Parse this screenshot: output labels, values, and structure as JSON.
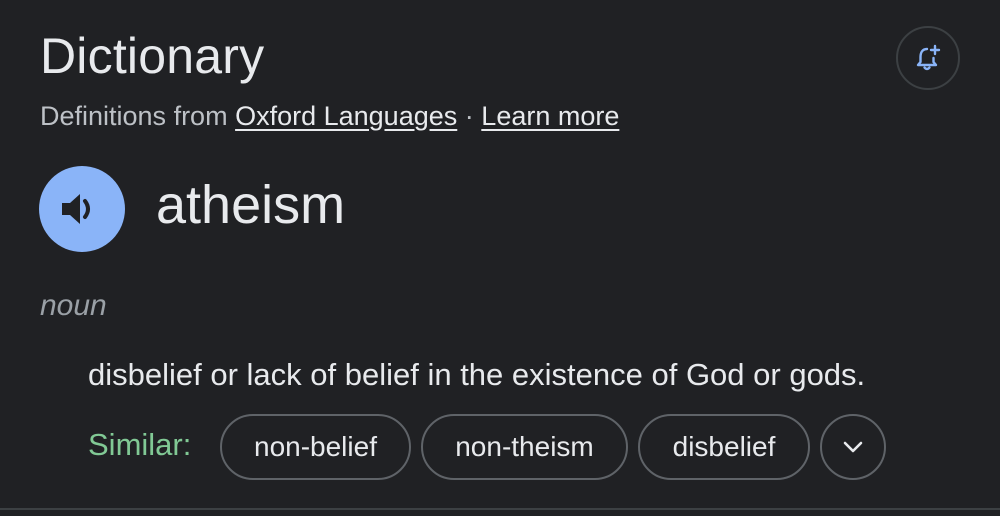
{
  "header": {
    "title": "Dictionary",
    "source_prefix": "Definitions from",
    "source_link": "Oxford Languages",
    "separator": "·",
    "learn_more": "Learn more"
  },
  "entry": {
    "word": "atheism",
    "part_of_speech": "noun",
    "definition": "disbelief or lack of belief in the existence of God or gods."
  },
  "similar": {
    "label": "Similar:",
    "chips": [
      "non-belief",
      "non-theism",
      "disbelief"
    ]
  },
  "icons": {
    "alert": "add-alert-icon",
    "audio": "speaker-icon",
    "expand": "chevron-down-icon"
  },
  "colors": {
    "background": "#202124",
    "text_primary": "#e8eaed",
    "text_secondary": "#bdc1c6",
    "audio_button": "#8ab4f8",
    "similar_label": "#81c995",
    "chip_border": "#5f6368"
  }
}
